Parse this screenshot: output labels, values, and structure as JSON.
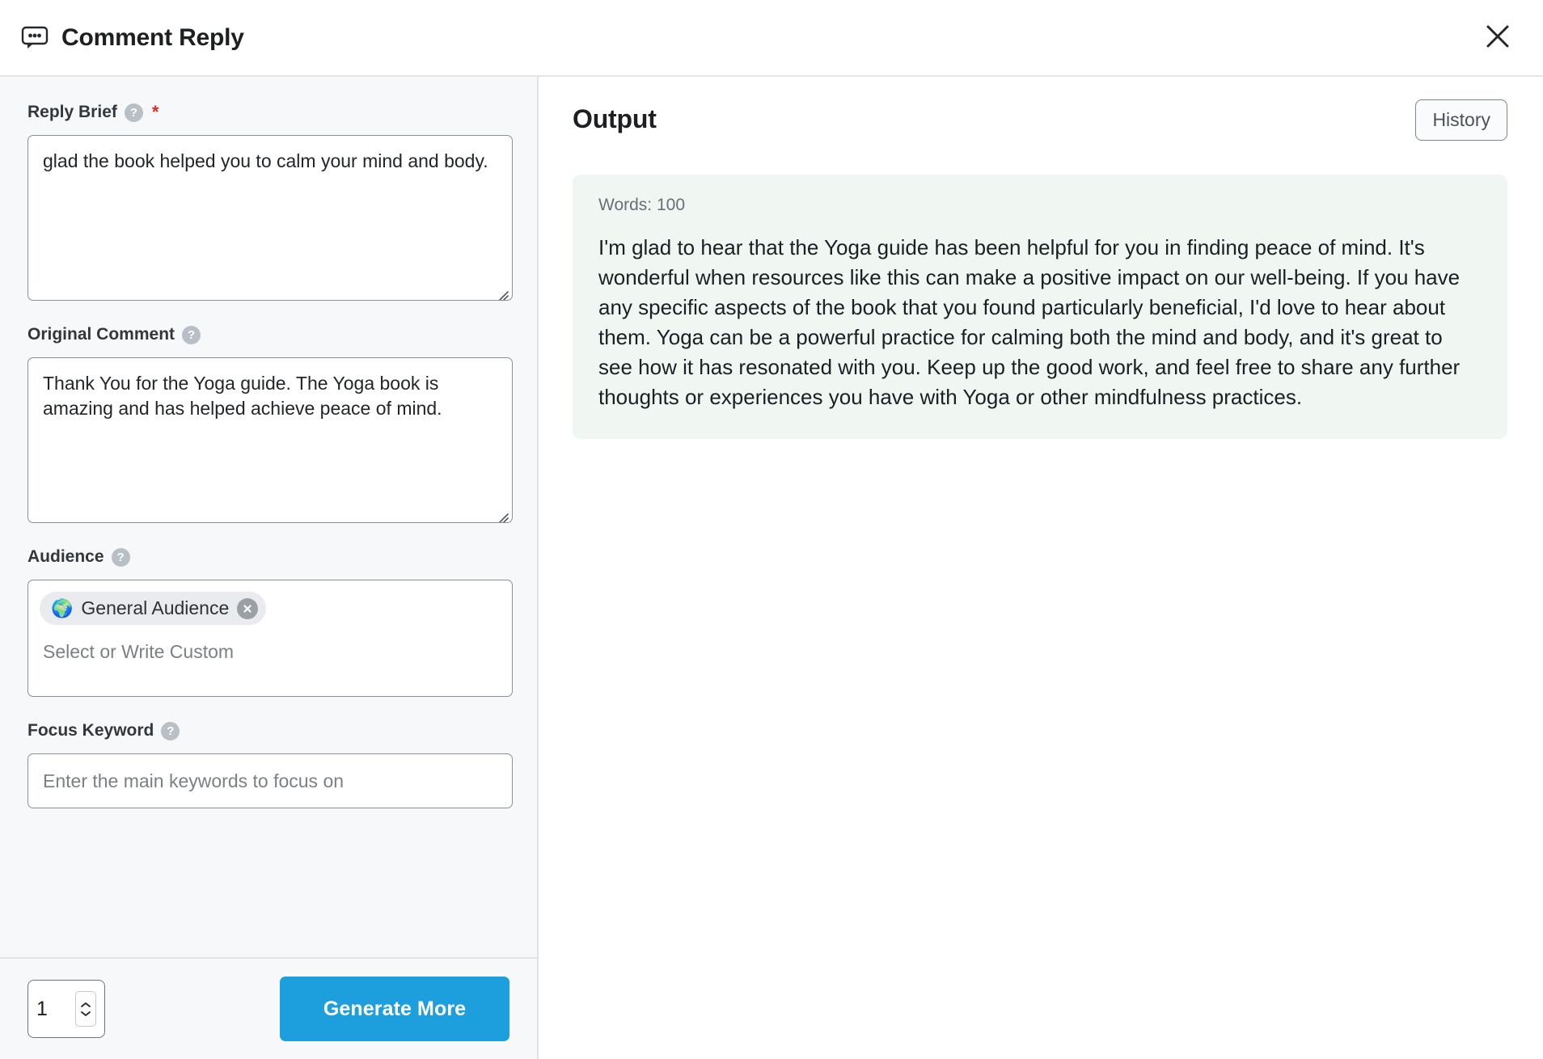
{
  "header": {
    "title": "Comment Reply",
    "icon": "comment-bubble-icon",
    "close_icon": "close-icon"
  },
  "form": {
    "reply_brief": {
      "label": "Reply Brief",
      "help_icon": "help-icon",
      "required_marker": "*",
      "value": "glad the book helped you to calm your mind and body."
    },
    "original_comment": {
      "label": "Original Comment",
      "help_icon": "help-icon",
      "value": "Thank You for the Yoga guide. The Yoga book is amazing and has helped achieve peace of mind."
    },
    "audience": {
      "label": "Audience",
      "help_icon": "help-icon",
      "chips": [
        {
          "emoji": "🌍",
          "label": "General Audience",
          "remove_icon": "close-icon"
        }
      ],
      "placeholder": "Select or Write Custom"
    },
    "focus_keyword": {
      "label": "Focus Keyword",
      "help_icon": "help-icon",
      "placeholder": "Enter the main keywords to focus on",
      "value": ""
    }
  },
  "footer": {
    "count_value": "1",
    "generate_label": "Generate More"
  },
  "output": {
    "title": "Output",
    "history_label": "History",
    "words_label": "Words: 100",
    "text": "I'm glad to hear that the Yoga guide has been helpful for you in finding peace of mind. It's wonderful when resources like this can make a positive impact on our well-being. If you have any specific aspects of the book that you found particularly beneficial, I'd love to hear about them. Yoga can be a powerful practice for calming both the mind and body, and it's great to see how it has resonated with you. Keep up the good work, and feel free to share any further thoughts or experiences you have with Yoga or other mindfulness practices."
  },
  "colors": {
    "accent_blue": "#1d9fdd",
    "panel_bg": "#f7f8fa",
    "output_card_bg": "#f0f7f3",
    "required_red": "#e02b2b"
  }
}
